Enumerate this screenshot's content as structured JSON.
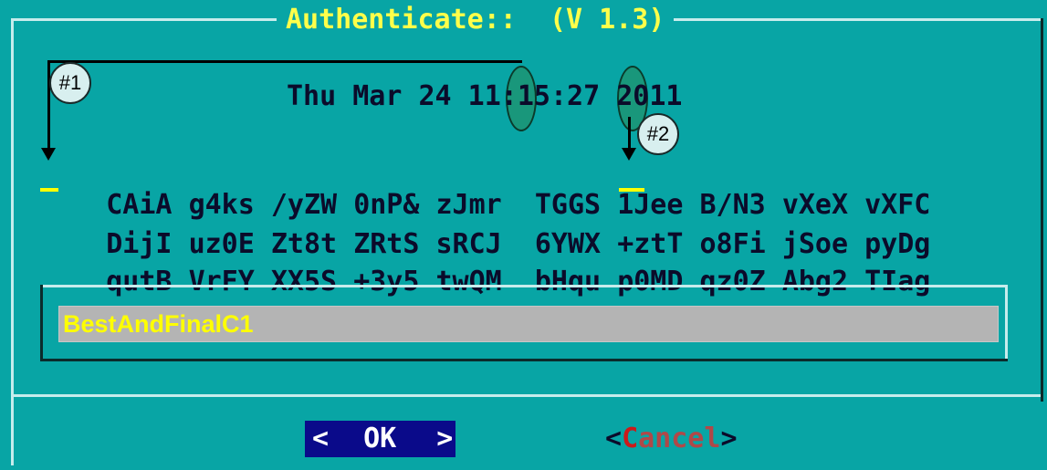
{
  "dialog": {
    "title": "Authenticate::  (V 1.3)",
    "datetime": "Thu Mar 24 11:15:27 2011"
  },
  "grid": {
    "rows": [
      [
        "CAiA",
        "g4ks",
        "/yZW",
        "0nP&",
        "zJmr",
        "TGGS",
        "1Jee",
        "B/N3",
        "vXeX",
        "vXFC"
      ],
      [
        "DijI",
        "uz0E",
        "Zt8t",
        "ZRtS",
        "sRCJ",
        "6YWX",
        "+ztT",
        "o8Fi",
        "jSoe",
        "pyDg"
      ],
      [
        "qutB",
        "VrFY",
        "XX5S",
        "+3y5",
        "twQM",
        "bHqu",
        "p0MD",
        "qz0Z",
        "Abg2",
        "TIag"
      ]
    ]
  },
  "annotations": {
    "marker1": "#1",
    "marker2": "#2"
  },
  "password": {
    "value": "BestAndFinalC1"
  },
  "buttons": {
    "ok_left": "<",
    "ok_label": "OK",
    "ok_right": ">",
    "cancel_open": "<",
    "cancel_c": "C",
    "cancel_rest": "ance",
    "cancel_l": "l",
    "cancel_close": ">"
  },
  "colors": {
    "background": "#08a5a5",
    "title": "#ffff4a",
    "ok_button": "#0a0a8a",
    "input_text": "#ffff00"
  }
}
